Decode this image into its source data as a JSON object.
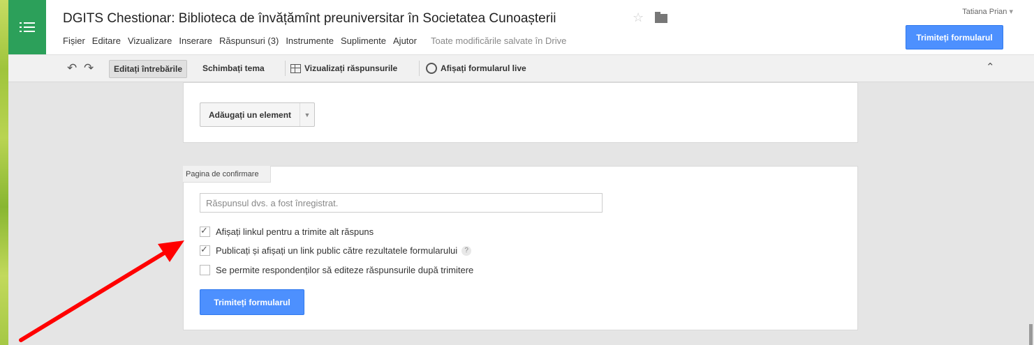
{
  "header": {
    "title": "DGITS Chestionar: Biblioteca de învățămînt preuniversitar în Societatea Cunoașterii",
    "user": "Tatiana Prian",
    "send_label": "Trimiteți formularul",
    "menu": [
      "Fișier",
      "Editare",
      "Vizualizare",
      "Inserare",
      "Răspunsuri (3)",
      "Instrumente",
      "Suplimente",
      "Ajutor"
    ],
    "saved_status": "Toate modificările salvate în Drive"
  },
  "toolbar": {
    "edit_questions": "Editați întrebările",
    "change_theme": "Schimbați tema",
    "view_responses": "Vizualizați răspunsurile",
    "view_live": "Afișați formularul live"
  },
  "add_item": {
    "label": "Adăugați un element"
  },
  "confirmation": {
    "section_label": "Pagina de confirmare",
    "message_value": "Răspunsul dvs. a fost înregistrat.",
    "options": [
      {
        "label": "Afișați linkul pentru a trimite alt răspuns",
        "checked": true
      },
      {
        "label": "Publicați și afișați un link public către rezultatele formularului",
        "checked": true
      },
      {
        "label": "Se permite respondenților să editeze răspunsurile după trimitere",
        "checked": false
      }
    ],
    "help_glyph": "?",
    "send_label": "Trimiteți formularul"
  },
  "colors": {
    "accent": "#4d90fe",
    "app_green": "#2ca05a",
    "arrow": "#ff0000"
  }
}
